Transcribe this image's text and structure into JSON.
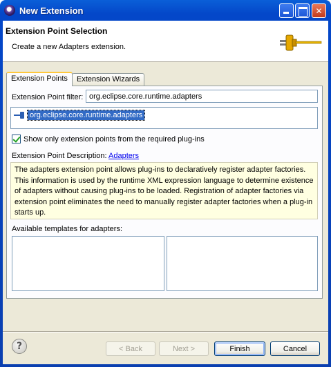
{
  "window": {
    "title": "New Extension"
  },
  "header": {
    "heading": "Extension Point Selection",
    "description": "Create a new Adapters extension.",
    "icon": "plug-icon"
  },
  "tabs": [
    {
      "label": "Extension Points",
      "active": true
    },
    {
      "label": "Extension Wizards",
      "active": false
    }
  ],
  "filter": {
    "label": "Extension Point filter:",
    "value": "org.eclipse.core.runtime.adapters"
  },
  "extension_list": {
    "items": [
      "org.eclipse.core.runtime.adapters"
    ],
    "selected_index": 0
  },
  "show_required_checkbox": {
    "label": "Show only extension points from the required plug-ins",
    "checked": true
  },
  "description": {
    "label": "Extension Point Description:",
    "link": "Adapters",
    "text": "The adapters extension point allows plug-ins to declaratively register adapter factories. This information is used by the runtime XML expression language to determine existence of adapters without causing plug-ins to be loaded. Registration of adapter factories via extension point eliminates the need to manually register adapter factories when a plug-in starts up."
  },
  "templates": {
    "label": "Available templates for adapters:"
  },
  "buttons": {
    "back": "< Back",
    "next": "Next >",
    "finish": "Finish",
    "cancel": "Cancel"
  },
  "colors": {
    "titlebar": "#0a5fd8",
    "selection": "#316ac5",
    "description_bg": "#ffffe1",
    "active_tab_accent": "#ffc83c"
  }
}
